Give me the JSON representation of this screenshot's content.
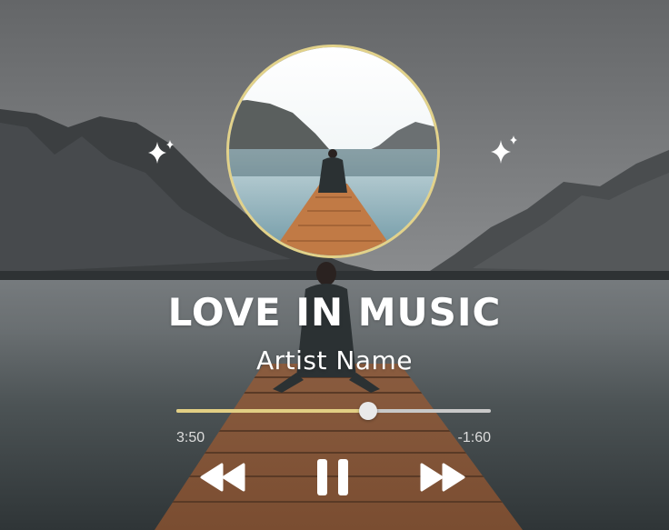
{
  "colors": {
    "progress_fill": "#e2cf84",
    "progress_track": "#c9c9c9",
    "cover_border": "#e2d28a",
    "controls": "#ffffff"
  },
  "song": {
    "title": "LOVE IN MUSIC",
    "artist": "Artist Name"
  },
  "progress": {
    "elapsed": "3:50",
    "remaining": "-1:60",
    "fraction": 0.61
  },
  "controls": {
    "previous_icon": "rewind-icon",
    "play_pause_icon": "pause-icon",
    "next_icon": "fast-forward-icon"
  },
  "decorations": {
    "left_icon": "sparkle-icon",
    "right_icon": "sparkle-icon"
  }
}
